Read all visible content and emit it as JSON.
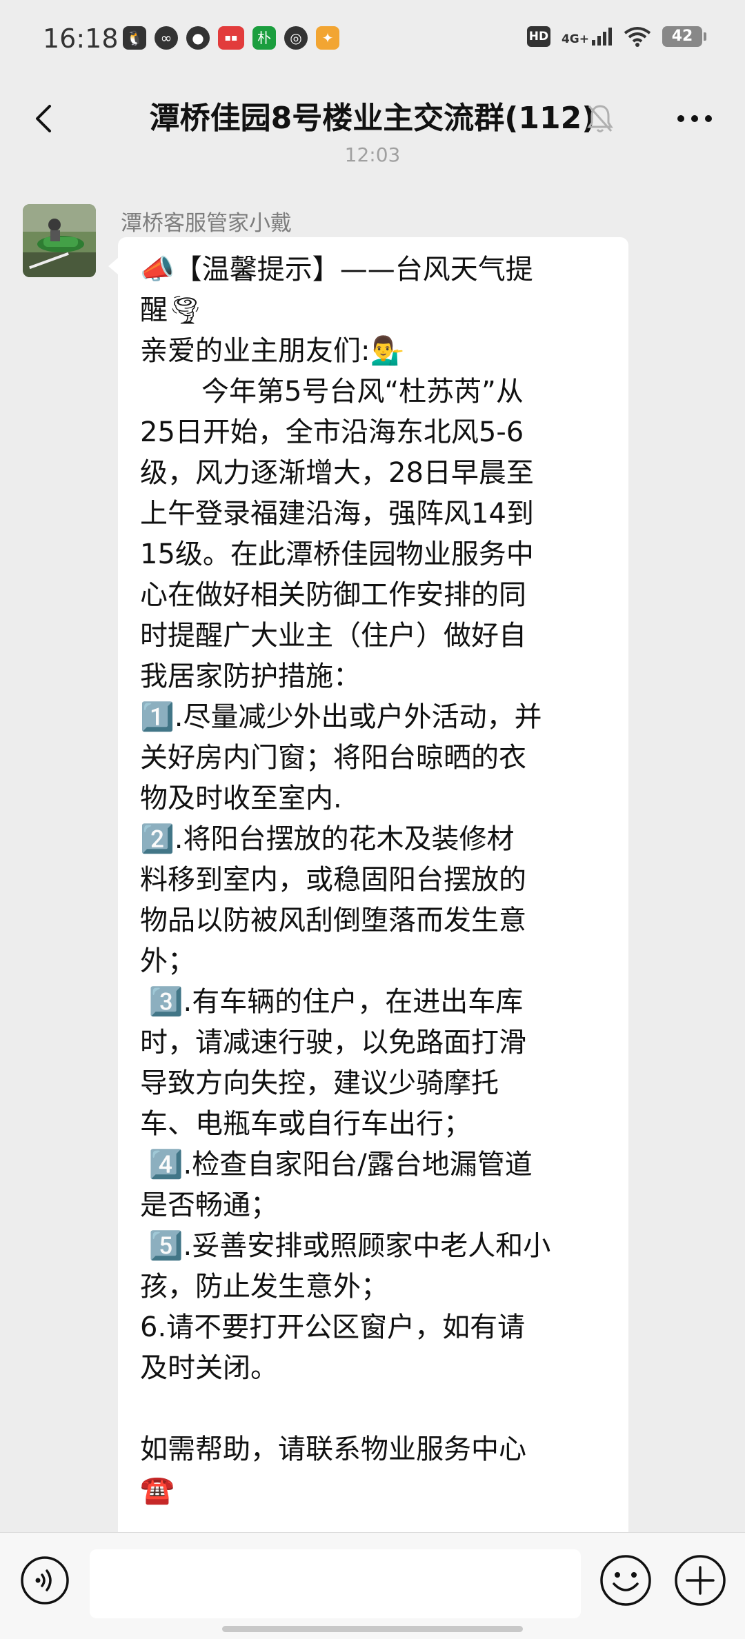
{
  "status_bar": {
    "time": "16:18",
    "left_icons": [
      "qq-penguin-icon",
      "link-icon",
      "chat-bubble-icon",
      "news-app-icon",
      "pu-app-icon",
      "camera-app-icon",
      "taobao-app-icon"
    ],
    "hd": "HD",
    "network": "4G+",
    "battery": "42"
  },
  "header": {
    "title": "潭桥佳园8号楼业主交流群(112)",
    "muted": true
  },
  "timestamp": "12:03",
  "message": {
    "sender": "潭桥客服管家小戴",
    "text": "📣【温馨提示】——台风天气提\n醒🌪\n亲爱的业主朋友们:💁‍♂️\n       今年第5号台风“杜苏芮”从\n25日开始，全市沿海东北风5-6\n级，风力逐渐增大，28日早晨至\n上午登录福建沿海，强阵风14到\n15级。在此潭桥佳园物业服务中\n心在做好相关防御工作安排的同\n时提醒广大业主（住户）做好自\n我居家防护措施：\n1️⃣.尽量减少外出或户外活动，并\n关好房内门窗；将阳台晾晒的衣\n物及时收至室内.\n2️⃣.将阳台摆放的花木及装修材\n料移到室内，或稳固阳台摆放的\n物品以防被风刮倒堕落而发生意\n外；\n 3️⃣.有车辆的住户，在进出车库\n时，请减速行驶，以免路面打滑\n导致方向失控，建议少骑摩托\n车、电瓶车或自行车出行；\n 4️⃣.检查自家阳台/露台地漏管道\n是否畅通；\n 5️⃣.妥善安排或照顾家中老人和小\n孩，防止发生意外；\n6.请不要打开公区窗户，如有请\n及时关闭。\n\n如需帮助，请联系物业服务中心\n☎️"
  },
  "input_bar": {
    "voice": "voice-icon",
    "emoji": "emoji-icon",
    "more": "plus-icon"
  },
  "colors": {
    "background": "#ededed",
    "bubble": "#ffffff",
    "sender": "#7d7d7d"
  }
}
